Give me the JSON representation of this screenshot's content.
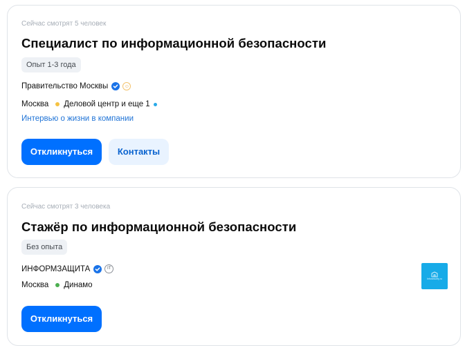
{
  "vacancies": [
    {
      "viewers": "Сейчас смотрят 5 человек",
      "title": "Специалист по информационной безопасности",
      "experience": "Опыт 1-3 года",
      "company": "Правительство Москвы",
      "city": "Москва",
      "metro": "Деловой центр и еще 1",
      "metro_color": "#f5c242",
      "metro_extra_color": "#29a9e8",
      "company_link": "Интервью о жизни в компании",
      "respond_label": "Откликнуться",
      "contacts_label": "Контакты"
    },
    {
      "viewers": "Сейчас смотрят 3 человека",
      "title": "Стажёр по информационной безопасности",
      "experience": "Без опыта",
      "company": "ИНФОРМЗАЩИТА",
      "company_badge": "IT",
      "city": "Москва",
      "metro": "Динамо",
      "metro_color": "#4caf50",
      "logo_text": "Infosecurity.ru",
      "respond_label": "Откликнуться"
    }
  ],
  "icons": {
    "verified": "verified-check-icon",
    "rating": "smile-rating-icon",
    "it_accreditation": "it-accreditation-icon",
    "company_logo": "company-logo"
  }
}
